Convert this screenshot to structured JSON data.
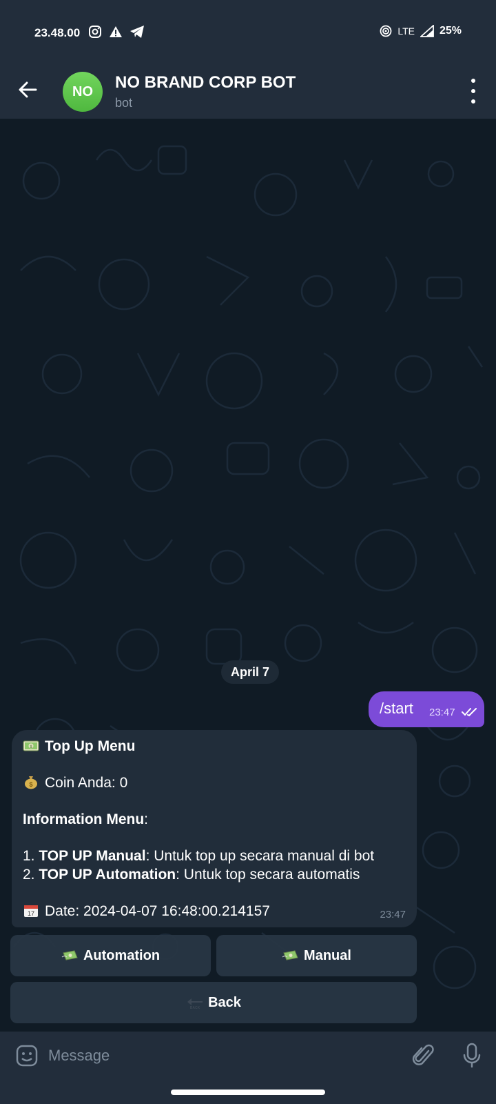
{
  "status_bar": {
    "time": "23.48.00",
    "network": "LTE",
    "battery": "25%"
  },
  "header": {
    "avatar_initials": "NO",
    "title": "NO BRAND CORP BOT",
    "subtitle": "bot"
  },
  "chat": {
    "date_label": "April 7",
    "outgoing": {
      "text": "/start",
      "time": "23:47"
    },
    "incoming": {
      "title": "Top Up Menu",
      "coin_label": "Coin Anda: 0",
      "info_label": "Information Menu",
      "info_colon": ":",
      "item1_bold": "TOP UP Manual",
      "item1_rest": ": Untuk top up secara manual di bot",
      "item2_bold": "TOP UP Automation",
      "item2_rest": ": Untuk top secara automatis",
      "date_line": "Date: 2024-04-07 16:48:00.214157",
      "time": "23:47"
    }
  },
  "keyboard": {
    "automation_label": "Automation",
    "manual_label": "Manual",
    "back_label": "Back"
  },
  "composer": {
    "placeholder": "Message"
  },
  "colors": {
    "outgoing_bubble": "#7c4bd8",
    "incoming_bubble": "#212d3a",
    "bar": "#222d3b",
    "avatar": "#5cc64a"
  }
}
